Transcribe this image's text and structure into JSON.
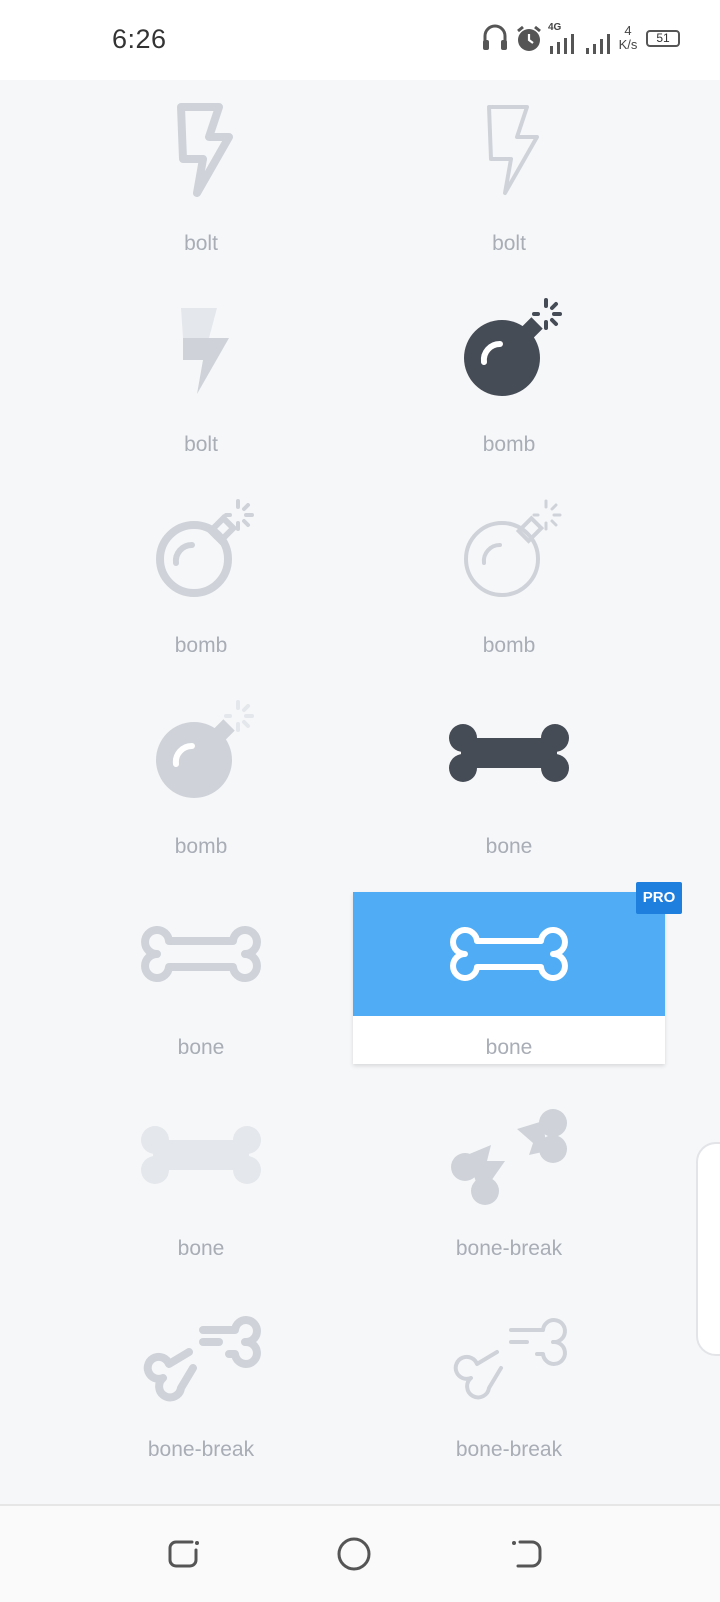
{
  "status_bar": {
    "time": "6:26",
    "network_type": "4G",
    "speed_value": "4",
    "speed_unit": "K/s",
    "battery": "51",
    "icons": [
      "headphones-icon",
      "alarm-icon",
      "signal-icon",
      "signal-icon",
      "battery-icon"
    ]
  },
  "icons": [
    {
      "label": "bolt",
      "style": "outline-bold",
      "icon": "bolt-icon"
    },
    {
      "label": "bolt",
      "style": "outline-thin",
      "icon": "bolt-icon"
    },
    {
      "label": "bolt",
      "style": "duotone",
      "icon": "bolt-icon"
    },
    {
      "label": "bomb",
      "style": "solid-dark",
      "icon": "bomb-icon"
    },
    {
      "label": "bomb",
      "style": "outline-bold",
      "icon": "bomb-icon"
    },
    {
      "label": "bomb",
      "style": "outline-thin",
      "icon": "bomb-icon"
    },
    {
      "label": "bomb",
      "style": "solid-light",
      "icon": "bomb-icon"
    },
    {
      "label": "bone",
      "style": "solid-dark",
      "icon": "bone-icon"
    },
    {
      "label": "bone",
      "style": "outline-bold",
      "icon": "bone-icon"
    },
    {
      "label": "bone",
      "style": "outline-selected",
      "icon": "bone-icon",
      "badge": "PRO",
      "selected": true
    },
    {
      "label": "bone",
      "style": "solid-light",
      "icon": "bone-icon"
    },
    {
      "label": "bone-break",
      "style": "solid-light",
      "icon": "bone-break-icon"
    },
    {
      "label": "bone-break",
      "style": "outline-bold",
      "icon": "bone-break-icon"
    },
    {
      "label": "bone-break",
      "style": "outline-thin",
      "icon": "bone-break-icon"
    }
  ],
  "colors": {
    "dark_icon": "#464c56",
    "light_icon": "#cfd3d9",
    "lighter_icon": "#e4e7eb",
    "selected_bg": "#4facf5",
    "pro_badge": "#1e7fdf",
    "label": "#a8adb6"
  },
  "nav_bar": {
    "buttons": [
      "recent-apps-icon",
      "home-icon",
      "back-icon"
    ]
  }
}
